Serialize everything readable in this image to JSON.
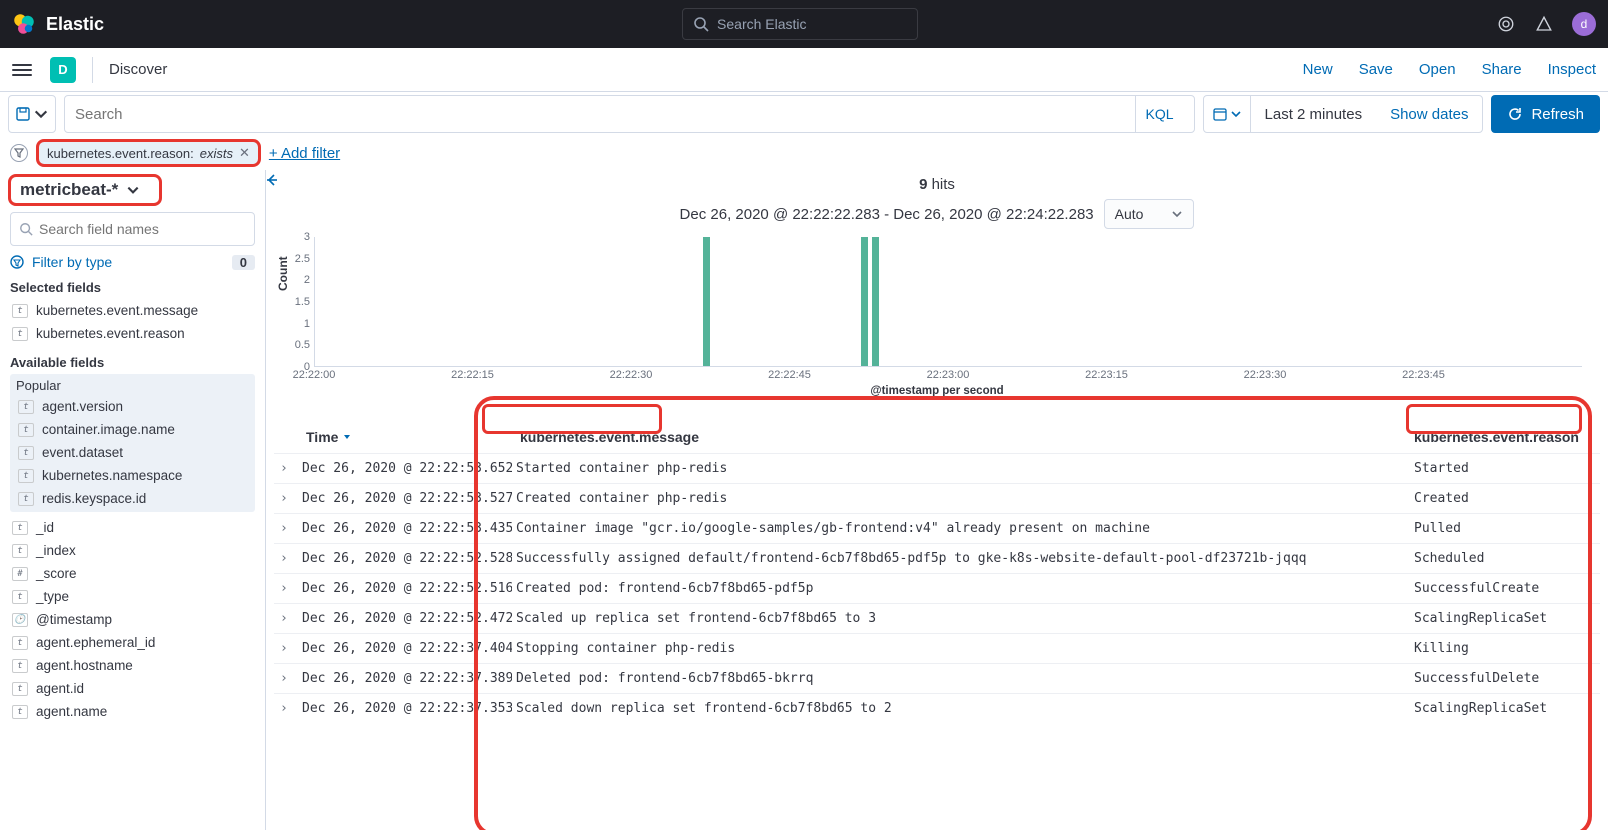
{
  "header": {
    "brand": "Elastic",
    "search_placeholder": "Search Elastic",
    "avatar_initial": "d"
  },
  "secondbar": {
    "space_initial": "D",
    "title": "Discover",
    "actions": {
      "new": "New",
      "save": "Save",
      "open": "Open",
      "share": "Share",
      "inspect": "Inspect"
    }
  },
  "querybar": {
    "search_placeholder": "Search",
    "kql": "KQL",
    "range_label": "Last 2 minutes",
    "show_dates": "Show dates",
    "refresh": "Refresh"
  },
  "filterbar": {
    "pill_field": "kubernetes.event.reason:",
    "pill_value": "exists",
    "add_filter": "+ Add filter"
  },
  "sidebar": {
    "index_pattern": "metricbeat-*",
    "field_search_placeholder": "Search field names",
    "filter_by_type": "Filter by type",
    "filter_count": "0",
    "selected_label": "Selected fields",
    "selected": [
      {
        "t": "t",
        "name": "kubernetes.event.message"
      },
      {
        "t": "t",
        "name": "kubernetes.event.reason"
      }
    ],
    "available_label": "Available fields",
    "popular_label": "Popular",
    "popular": [
      {
        "t": "t",
        "name": "agent.version"
      },
      {
        "t": "t",
        "name": "container.image.name"
      },
      {
        "t": "t",
        "name": "event.dataset"
      },
      {
        "t": "t",
        "name": "kubernetes.namespace"
      },
      {
        "t": "t",
        "name": "redis.keyspace.id"
      }
    ],
    "available": [
      {
        "t": "t",
        "name": "_id"
      },
      {
        "t": "t",
        "name": "_index"
      },
      {
        "t": "#",
        "name": "_score"
      },
      {
        "t": "t",
        "name": "_type"
      },
      {
        "t": "c",
        "name": "@timestamp"
      },
      {
        "t": "t",
        "name": "agent.ephemeral_id"
      },
      {
        "t": "t",
        "name": "agent.hostname"
      },
      {
        "t": "t",
        "name": "agent.id"
      },
      {
        "t": "t",
        "name": "agent.name"
      }
    ]
  },
  "content": {
    "hits_count": "9",
    "hits_label": "hits",
    "time_range": "Dec 26, 2020 @ 22:22:22.283 - Dec 26, 2020 @ 22:24:22.283",
    "interval": "Auto",
    "xlabel": "@timestamp per second",
    "ylabel": "Count",
    "columns": {
      "time": "Time",
      "message": "kubernetes.event.message",
      "reason": "kubernetes.event.reason"
    },
    "rows": [
      {
        "time": "Dec 26, 2020 @ 22:22:53.652",
        "msg": "Started container php-redis",
        "reason": "Started"
      },
      {
        "time": "Dec 26, 2020 @ 22:22:53.527",
        "msg": "Created container php-redis",
        "reason": "Created"
      },
      {
        "time": "Dec 26, 2020 @ 22:22:53.435",
        "msg": "Container image \"gcr.io/google-samples/gb-frontend:v4\" already present on machine",
        "reason": "Pulled"
      },
      {
        "time": "Dec 26, 2020 @ 22:22:52.528",
        "msg": "Successfully assigned default/frontend-6cb7f8bd65-pdf5p to gke-k8s-website-default-pool-df23721b-jqqq",
        "reason": "Scheduled"
      },
      {
        "time": "Dec 26, 2020 @ 22:22:52.516",
        "msg": "Created pod: frontend-6cb7f8bd65-pdf5p",
        "reason": "SuccessfulCreate"
      },
      {
        "time": "Dec 26, 2020 @ 22:22:52.472",
        "msg": "Scaled up replica set frontend-6cb7f8bd65 to 3",
        "reason": "ScalingReplicaSet"
      },
      {
        "time": "Dec 26, 2020 @ 22:22:37.404",
        "msg": "Stopping container php-redis",
        "reason": "Killing"
      },
      {
        "time": "Dec 26, 2020 @ 22:22:37.389",
        "msg": "Deleted pod: frontend-6cb7f8bd65-bkrrq",
        "reason": "SuccessfulDelete"
      },
      {
        "time": "Dec 26, 2020 @ 22:22:37.353",
        "msg": "Scaled down replica set frontend-6cb7f8bd65 to 2",
        "reason": "ScalingReplicaSet"
      }
    ]
  },
  "chart_data": {
    "type": "bar",
    "ylabel": "Count",
    "xlabel": "@timestamp per second",
    "ylim": [
      0,
      3
    ],
    "yticks": [
      0,
      0.5,
      1,
      1.5,
      2,
      2.5,
      3
    ],
    "xticks": [
      "22:22:00",
      "22:22:15",
      "22:22:30",
      "22:22:45",
      "22:23:00",
      "22:23:15",
      "22:23:30",
      "22:23:45"
    ],
    "x_seconds_range": [
      0,
      120
    ],
    "bars": [
      {
        "second": 37,
        "count": 3
      },
      {
        "second": 52,
        "count": 3
      },
      {
        "second": 53,
        "count": 3
      }
    ]
  }
}
